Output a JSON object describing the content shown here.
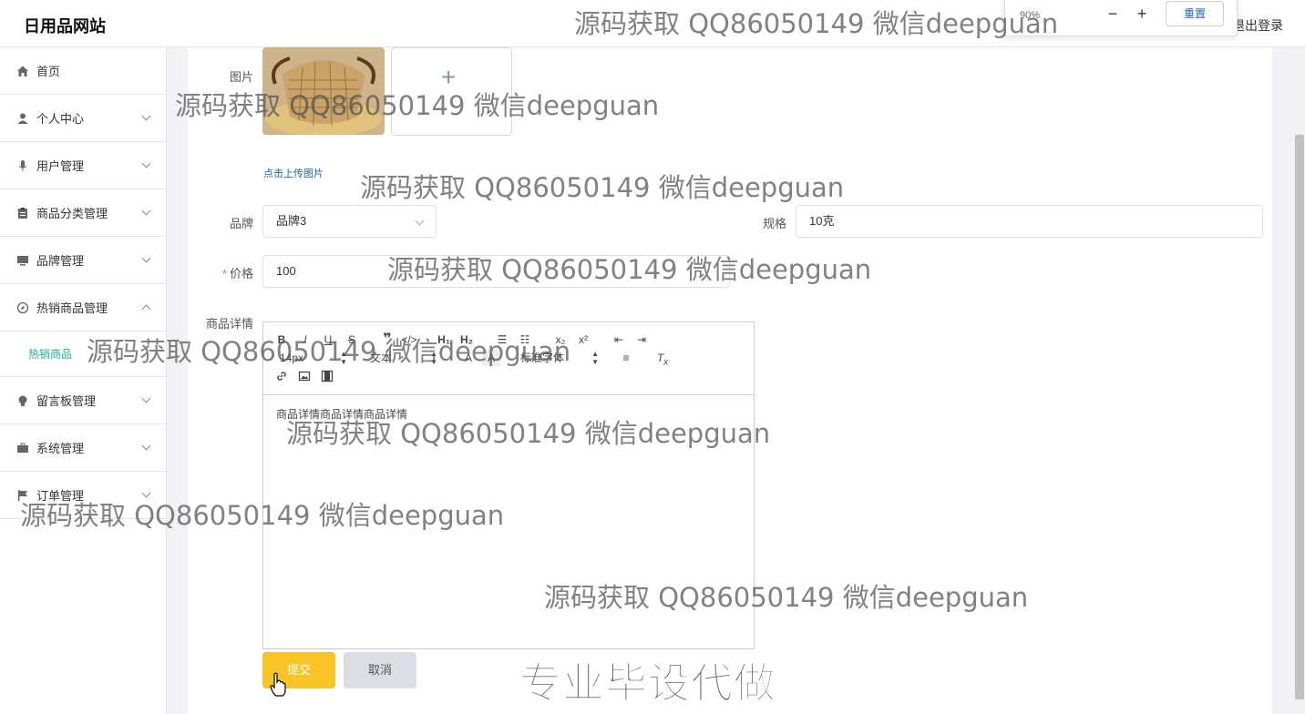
{
  "header": {
    "site_title": "日用品网站",
    "logout_label": "退出登录"
  },
  "zoom": {
    "level": "90%",
    "minus": "−",
    "plus": "+",
    "reset_label": "重置"
  },
  "sidebar": {
    "items": [
      {
        "label": "首页",
        "icon": "home-icon"
      },
      {
        "label": "个人中心",
        "icon": "user-icon"
      },
      {
        "label": "用户管理",
        "icon": "mic-icon"
      },
      {
        "label": "商品分类管理",
        "icon": "clipboard-icon"
      },
      {
        "label": "品牌管理",
        "icon": "monitor-icon"
      },
      {
        "label": "热销商品管理",
        "icon": "compass-icon"
      },
      {
        "label": "留言板管理",
        "icon": "bulb-icon"
      },
      {
        "label": "系统管理",
        "icon": "briefcase-icon"
      },
      {
        "label": "订单管理",
        "icon": "flag-icon"
      }
    ],
    "submenu": {
      "label": "热销商品"
    }
  },
  "form": {
    "image_label": "图片",
    "upload_hint": "点击上传图片",
    "brand_label": "品牌",
    "brand_value": "品牌3",
    "spec_label": "规格",
    "spec_value": "10克",
    "price_label": "价格",
    "price_required": "*",
    "price_value": "100",
    "detail_label": "商品详情",
    "editor": {
      "font_size": "14px",
      "text_type": "文本",
      "font_family": "标准字体",
      "content": "商品详情商品详情商品详情"
    },
    "submit_label": "提交",
    "cancel_label": "取消"
  },
  "watermarks": {
    "text": "源码获取 QQ86050149 微信deepguan",
    "banner": "专业毕设代做"
  },
  "colors": {
    "accent": "#1ab394",
    "submit": "#f7c325",
    "cancel": "#dcdde2",
    "link": "#1a66c4"
  }
}
